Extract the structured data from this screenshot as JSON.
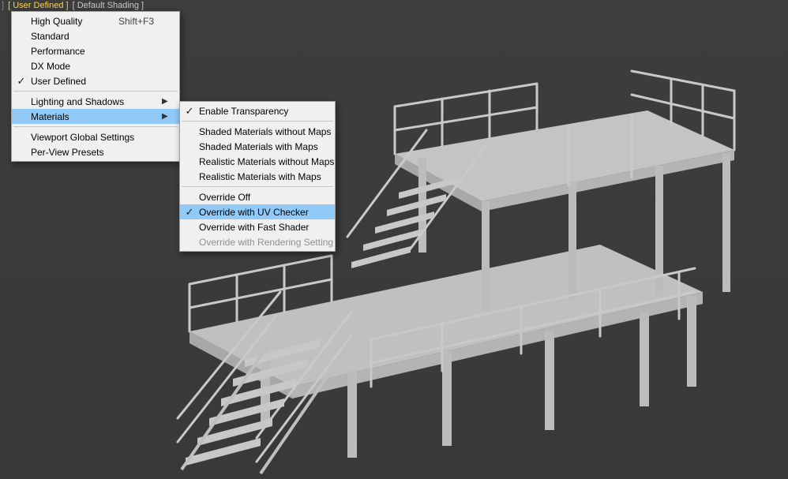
{
  "viewport_labels": {
    "part0": "]",
    "active": "[ User Defined ]",
    "inactive": "[ Default Shading ]"
  },
  "menu1": {
    "high_quality": {
      "label": "High Quality",
      "shortcut": "Shift+F3"
    },
    "standard": {
      "label": "Standard"
    },
    "performance": {
      "label": "Performance"
    },
    "dx_mode": {
      "label": "DX Mode"
    },
    "user_defined": {
      "label": "User Defined",
      "check": "✓"
    },
    "lighting": {
      "label": "Lighting and Shadows",
      "arrow": "▶"
    },
    "materials": {
      "label": "Materials",
      "arrow": "▶"
    },
    "vp_global": {
      "label": "Viewport Global Settings"
    },
    "per_view": {
      "label": "Per-View Presets"
    }
  },
  "menu2": {
    "enable_trans": {
      "label": "Enable Transparency",
      "check": "✓"
    },
    "sm_wo_maps": {
      "label": "Shaded Materials without Maps"
    },
    "sm_w_maps": {
      "label": "Shaded Materials with Maps"
    },
    "rm_wo_maps": {
      "label": "Realistic Materials without Maps"
    },
    "rm_w_maps": {
      "label": "Realistic Materials with Maps"
    },
    "override_off": {
      "label": "Override Off"
    },
    "override_uv": {
      "label": "Override with UV Checker",
      "check": "✓"
    },
    "override_fast": {
      "label": "Override with Fast Shader"
    },
    "override_rend": {
      "label": "Override with Rendering Setting"
    }
  }
}
